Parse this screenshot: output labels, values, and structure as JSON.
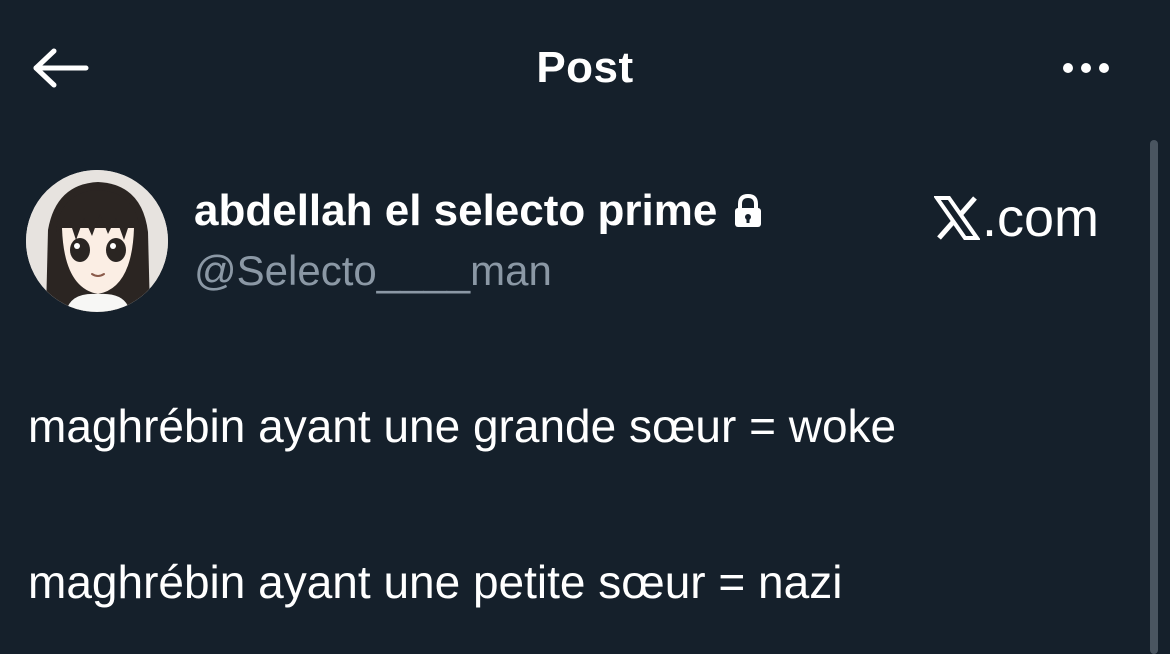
{
  "header": {
    "title": "Post",
    "back_icon": "arrow-left-icon",
    "more_icon": "more-horizontal-icon"
  },
  "author": {
    "display_name": "abdellah el selecto prime",
    "handle": "@Selecto____man",
    "protected_icon": "lock-icon",
    "avatar_icon": "anime-girl-avatar"
  },
  "watermark": {
    "text": ".com",
    "logo_icon": "x-logo-icon"
  },
  "tweet": {
    "lines": [
      "maghrébin ayant une grande sœur = woke",
      "maghrébin ayant une petite sœur = nazi"
    ]
  },
  "colors": {
    "background": "#15202b",
    "text_primary": "#ffffff",
    "text_secondary": "#8b98a5"
  }
}
